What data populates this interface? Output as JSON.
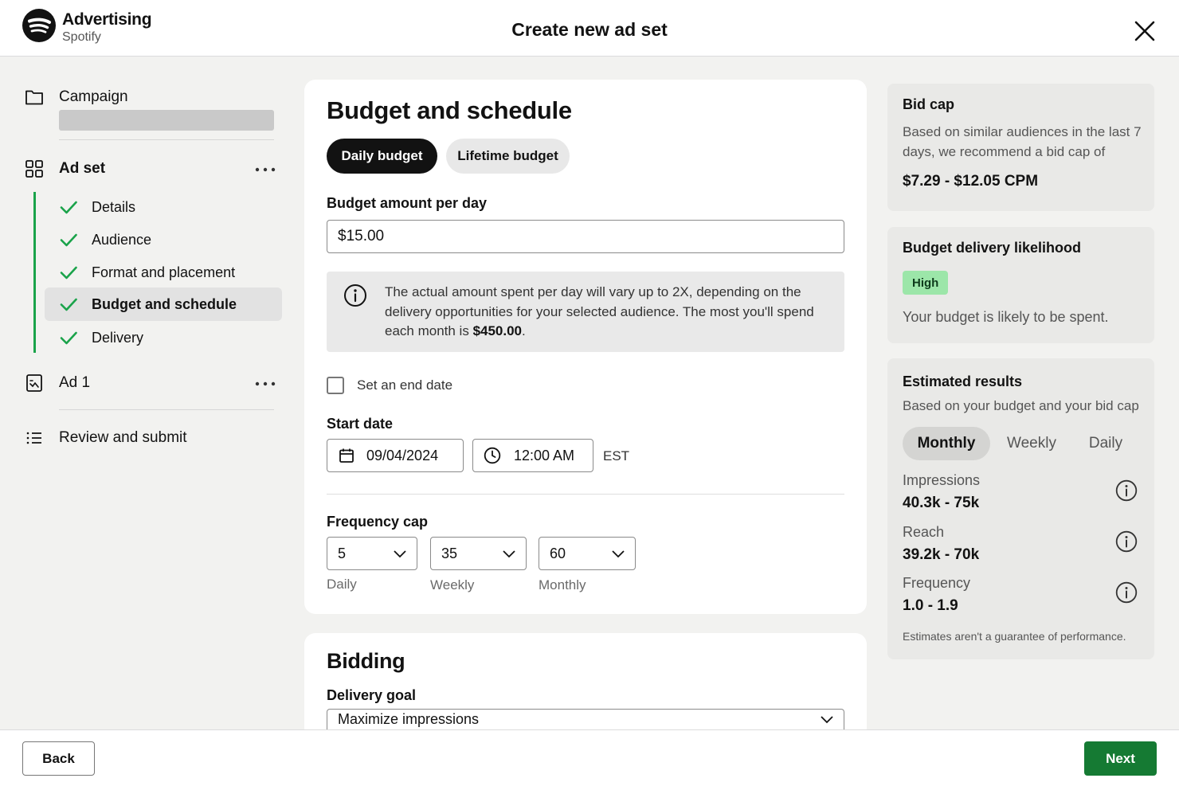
{
  "header": {
    "brand_title": "Advertising",
    "brand_subtitle": "Spotify",
    "page_title": "Create new ad set"
  },
  "sidebar": {
    "campaign_label": "Campaign",
    "ad_set_label": "Ad set",
    "steps": [
      {
        "label": "Details",
        "status": "complete"
      },
      {
        "label": "Audience",
        "status": "complete"
      },
      {
        "label": "Format and placement",
        "status": "complete"
      },
      {
        "label": "Budget and schedule",
        "status": "complete",
        "active": true
      },
      {
        "label": "Delivery",
        "status": "complete"
      }
    ],
    "ad_label": "Ad 1",
    "review_label": "Review and submit",
    "more_icon": "more-horizontal-icon"
  },
  "budget": {
    "title": "Budget and schedule",
    "tabs": [
      {
        "label": "Daily budget",
        "selected": true
      },
      {
        "label": "Lifetime budget",
        "selected": false
      }
    ],
    "amount_label": "Budget amount per day",
    "amount_value": "$15.00",
    "info_text": "The actual amount spent per day will vary up to 2X, depending on the delivery opportunities for your selected audience. The most you'll spend each month is ",
    "info_amount": "$450.00",
    "info_suffix": ".",
    "end_date_label": "Set an end date",
    "end_date_checked": false,
    "start_date_label": "Start date",
    "start_date": "09/04/2024",
    "start_time": "12:00 AM",
    "timezone": "EST",
    "frequency_label": "Frequency cap",
    "frequency": [
      {
        "value": "5",
        "label": "Daily"
      },
      {
        "value": "35",
        "label": "Weekly"
      },
      {
        "value": "60",
        "label": "Monthly"
      }
    ]
  },
  "bidding": {
    "title": "Bidding",
    "goal_label": "Delivery goal",
    "goal_value": "Maximize impressions"
  },
  "bid_cap": {
    "title": "Bid cap",
    "text": "Based on similar audiences in the last 7 days, we recommend a bid cap of",
    "range": "$7.29 - $12.05 CPM"
  },
  "likelihood": {
    "title": "Budget delivery likelihood",
    "badge": "High",
    "badge_color": "#9ce6a9",
    "text": "Your budget is likely to be spent."
  },
  "estimates": {
    "title": "Estimated results",
    "subtitle": "Based on your budget and your bid cap",
    "periods": [
      {
        "label": "Monthly",
        "selected": true
      },
      {
        "label": "Weekly",
        "selected": false
      },
      {
        "label": "Daily",
        "selected": false
      }
    ],
    "metrics": [
      {
        "label": "Impressions",
        "value": "40.3k - 75k"
      },
      {
        "label": "Reach",
        "value": "39.2k - 70k"
      },
      {
        "label": "Frequency",
        "value": "1.0 - 1.9"
      }
    ],
    "disclaimer": "Estimates aren't a guarantee of performance."
  },
  "footer": {
    "back_label": "Back",
    "next_label": "Next",
    "next_color": "#157a33"
  }
}
